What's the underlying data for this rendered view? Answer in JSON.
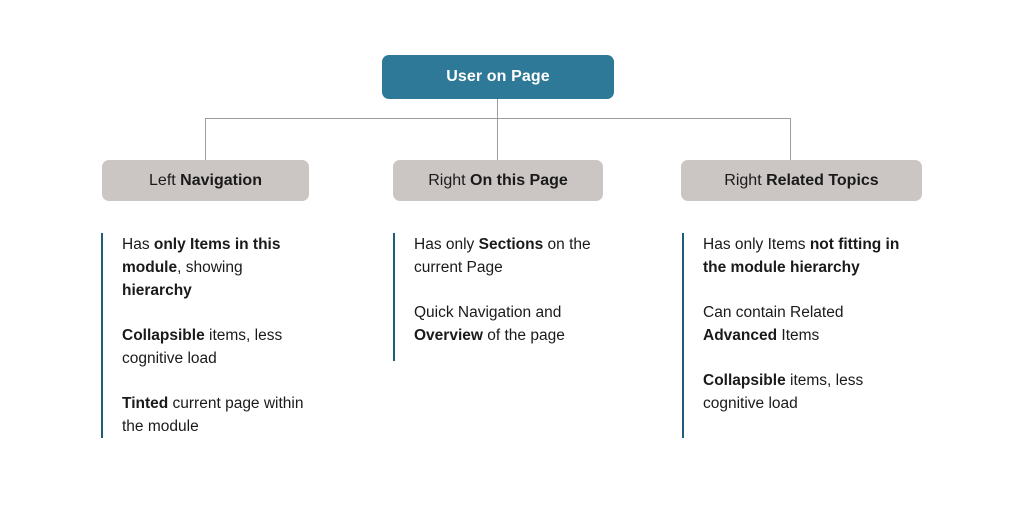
{
  "diagram": {
    "root": {
      "label": "User on Page",
      "color": "#2e7898"
    },
    "connector_color": "#9b9b9b",
    "branch_box_color": "#cbc6c4",
    "accent_color": "#1f5c7a",
    "branches": [
      {
        "header_lead": "Left ",
        "header_emph": "Navigation",
        "header_full": "Left Navigation",
        "points": [
          {
            "html": "Has <b>only Items in this module</b>, showing <b>hierarchy</b>",
            "text": "Has only Items in this module, showing hierarchy"
          },
          {
            "html": "<b>Collapsible</b> items, less cognitive load",
            "text": "Collapsible items, less cognitive load"
          },
          {
            "html": "<b>Tinted</b> current page within the module",
            "text": "Tinted current page within the module"
          }
        ]
      },
      {
        "header_lead": "Right ",
        "header_emph": "On this Page",
        "header_full": "Right On this Page",
        "points": [
          {
            "html": "Has only <b>Sections</b> on the current Page",
            "text": "Has only Sections on the current Page"
          },
          {
            "html": "Quick Navigation and <b>Overview</b> of the page",
            "text": "Quick Navigation and Overview of the page"
          }
        ]
      },
      {
        "header_lead": "Right ",
        "header_emph": "Related Topics",
        "header_full": "Right Related Topics",
        "points": [
          {
            "html": "Has only Items <b>not fitting in the module hierarchy</b>",
            "text": "Has only Items not fitting in the module hierarchy"
          },
          {
            "html": "Can contain Related <b>Advanced</b> Items",
            "text": "Can contain Related Advanced Items"
          },
          {
            "html": "<b>Collapsible</b> items, less cognitive load",
            "text": "Collapsible items, less cognitive load"
          }
        ]
      }
    ]
  }
}
